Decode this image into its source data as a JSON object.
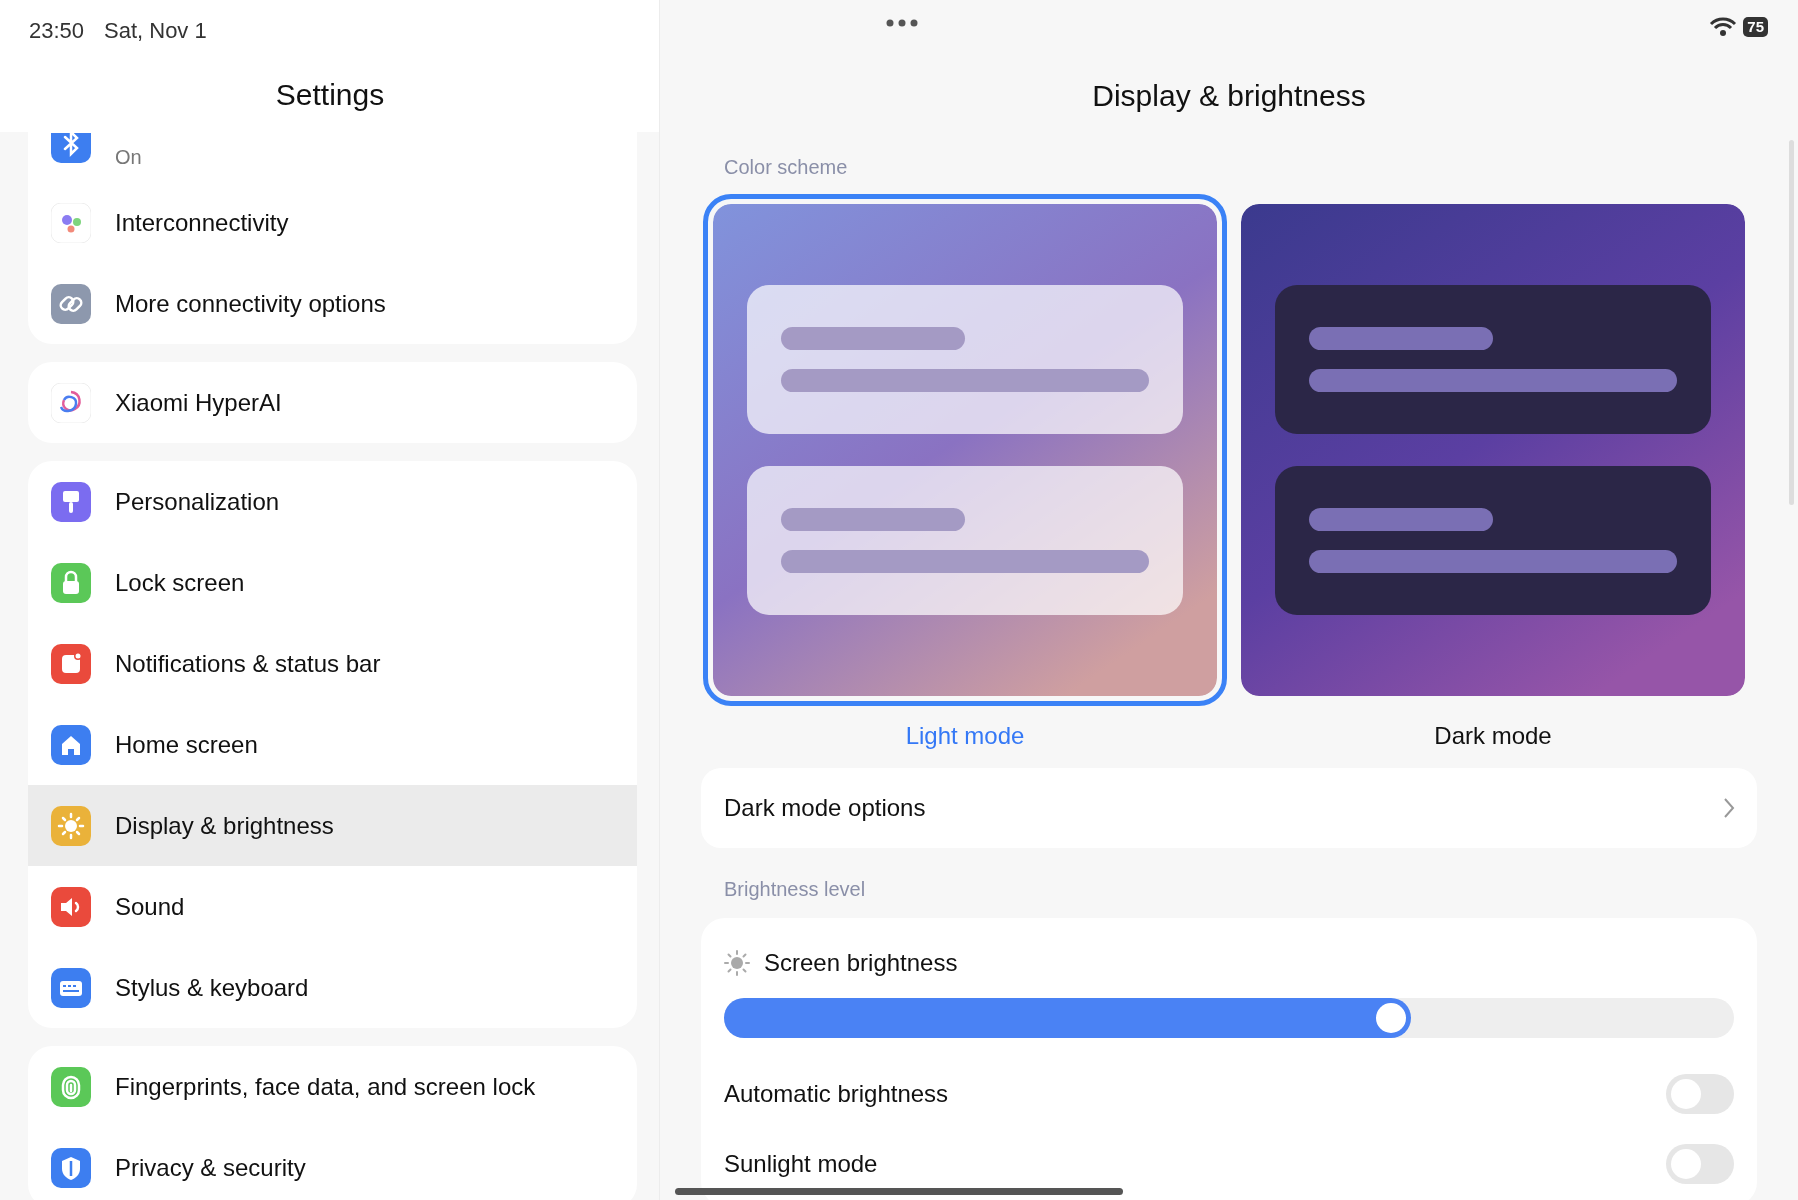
{
  "status_bar": {
    "time": "23:50",
    "date": "Sat, Nov 1",
    "battery": "75"
  },
  "sidebar": {
    "title": "Settings",
    "groups": [
      [
        {
          "sublabel": "On",
          "selected": false
        },
        {
          "label": "Interconnectivity",
          "selected": false
        },
        {
          "label": "More connectivity options",
          "selected": false
        }
      ],
      [
        {
          "label": "Xiaomi HyperAI",
          "selected": false
        }
      ],
      [
        {
          "label": "Personalization",
          "selected": false
        },
        {
          "label": "Lock screen",
          "selected": false
        },
        {
          "label": "Notifications & status bar",
          "selected": false
        },
        {
          "label": "Home screen",
          "selected": false
        },
        {
          "label": "Display & brightness",
          "selected": true
        },
        {
          "label": "Sound",
          "selected": false
        },
        {
          "label": "Stylus & keyboard",
          "selected": false
        }
      ],
      [
        {
          "label": "Fingerprints, face data, and screen lock",
          "selected": false
        },
        {
          "label": "Privacy & security",
          "selected": false
        }
      ]
    ]
  },
  "detail": {
    "title": "Display & brightness",
    "color_scheme": {
      "label": "Color scheme",
      "options": [
        {
          "label": "Light mode",
          "selected": true
        },
        {
          "label": "Dark mode",
          "selected": false
        }
      ]
    },
    "dark_mode_options": "Dark mode options",
    "brightness": {
      "label": "Brightness level",
      "screen_brightness": {
        "label": "Screen brightness",
        "level": 0.68
      },
      "toggles": [
        {
          "label": "Automatic brightness",
          "on": false
        },
        {
          "label": "Sunlight mode",
          "on": false
        }
      ]
    }
  }
}
